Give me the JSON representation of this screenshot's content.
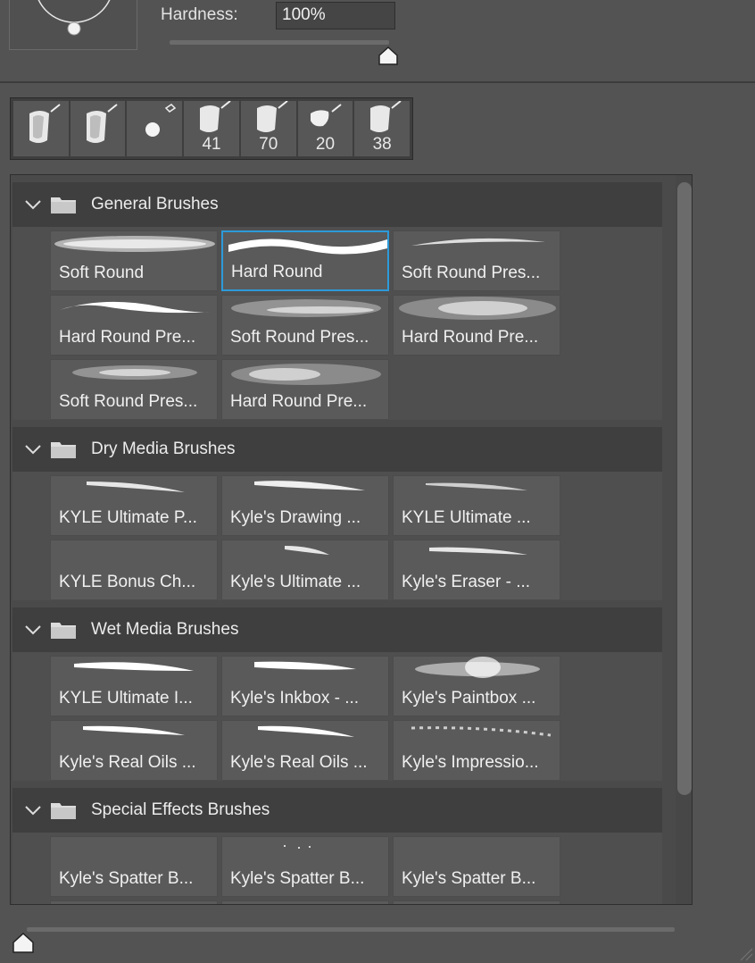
{
  "hardness": {
    "label": "Hardness:",
    "value": "100%",
    "slider_value_percent": 100
  },
  "recent_brushes": [
    {
      "icon": "brush-preset-icon",
      "size": ""
    },
    {
      "icon": "brush-preset-icon",
      "size": ""
    },
    {
      "icon": "eraser-dot-icon",
      "size": ""
    },
    {
      "icon": "brush-preset-icon",
      "size": "41"
    },
    {
      "icon": "brush-preset-icon",
      "size": "70"
    },
    {
      "icon": "splatter-brush-icon",
      "size": "20"
    },
    {
      "icon": "brush-preset-icon",
      "size": "38"
    }
  ],
  "groups": [
    {
      "name": "General Brushes",
      "brushes": [
        "Soft Round",
        "Hard Round",
        "Soft Round Pres...",
        "Hard Round Pre...",
        "Soft Round Pres...",
        "Hard Round Pre...",
        "Soft Round Pres...",
        "Hard Round Pre..."
      ],
      "selected_index": 1
    },
    {
      "name": "Dry Media Brushes",
      "brushes": [
        "KYLE Ultimate P...",
        "Kyle's Drawing ...",
        "KYLE Ultimate ...",
        "KYLE Bonus Ch...",
        "Kyle's Ultimate ...",
        "Kyle's Eraser - ..."
      ]
    },
    {
      "name": "Wet Media Brushes",
      "brushes": [
        "KYLE Ultimate I...",
        "Kyle's Inkbox - ...",
        "Kyle's Paintbox ...",
        "Kyle's Real Oils ...",
        "Kyle's Real Oils ...",
        "Kyle's Impressio..."
      ]
    },
    {
      "name": "Special Effects Brushes",
      "brushes": [
        "Kyle's Spatter B...",
        "Kyle's Spatter B...",
        "Kyle's Spatter B..."
      ]
    }
  ],
  "colors": {
    "panel_bg": "#535353",
    "header_bg": "#3f3f3f",
    "tile_bg": "#5a5a5a",
    "selection_accent": "#2d9ad9"
  }
}
